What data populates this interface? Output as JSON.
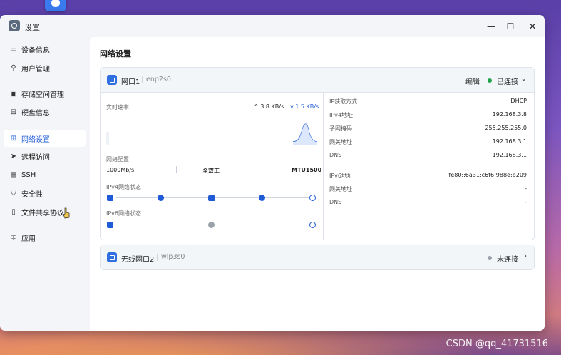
{
  "watermark": "CSDN @qq_41731516",
  "window": {
    "title": "设置",
    "controls": [
      "—",
      "☐",
      "✕"
    ]
  },
  "sidebar": {
    "items": [
      {
        "label": "设备信息",
        "icon": "monitor-icon"
      },
      {
        "label": "用户管理",
        "icon": "user-icon"
      },
      {
        "label": "存储空间管理",
        "icon": "storage-icon"
      },
      {
        "label": "硬盘信息",
        "icon": "disk-icon"
      },
      {
        "label": "网络设置",
        "icon": "network-icon",
        "active": true
      },
      {
        "label": "远程访问",
        "icon": "send-icon"
      },
      {
        "label": "SSH",
        "icon": "terminal-icon"
      },
      {
        "label": "安全性",
        "icon": "shield-icon"
      },
      {
        "label": "文件共享协议",
        "icon": "file-share-icon"
      },
      {
        "label": "应用",
        "icon": "apps-icon"
      }
    ]
  },
  "page": {
    "title": "网络设置"
  },
  "nic1": {
    "name": "网口1",
    "device": "enp2s0",
    "edit": "编辑",
    "status": "已连接",
    "status_color": "#1fa34a",
    "realtime_label": "实时速率",
    "upload": "^ 3.8 KB/s",
    "download": "v 1.5 KB/s",
    "config_label": "网络配置",
    "speed": "1000Mb/s",
    "duplex": "全双工",
    "mtu": "MTU1500",
    "ipv4_state_label": "IPv4网络状态",
    "ipv6_state_label": "IPv6网络状态",
    "info_ipv4": [
      {
        "k": "IP获取方式",
        "v": "DHCP"
      },
      {
        "k": "IPv4地址",
        "v": "192.168.3.8"
      },
      {
        "k": "子网掩码",
        "v": "255.255.255.0"
      },
      {
        "k": "网关地址",
        "v": "192.168.3.1"
      },
      {
        "k": "DNS",
        "v": "192.168.3.1"
      }
    ],
    "info_ipv6": [
      {
        "k": "IPv6地址",
        "v": "fe80::6a31:c6f6:988e:b209"
      },
      {
        "k": "网关地址",
        "v": "-"
      },
      {
        "k": "DNS",
        "v": "-"
      }
    ]
  },
  "nic2": {
    "name": "无线网口2",
    "device": "wlp3s0",
    "status": "未连接",
    "status_color": "#9aa1ab"
  }
}
